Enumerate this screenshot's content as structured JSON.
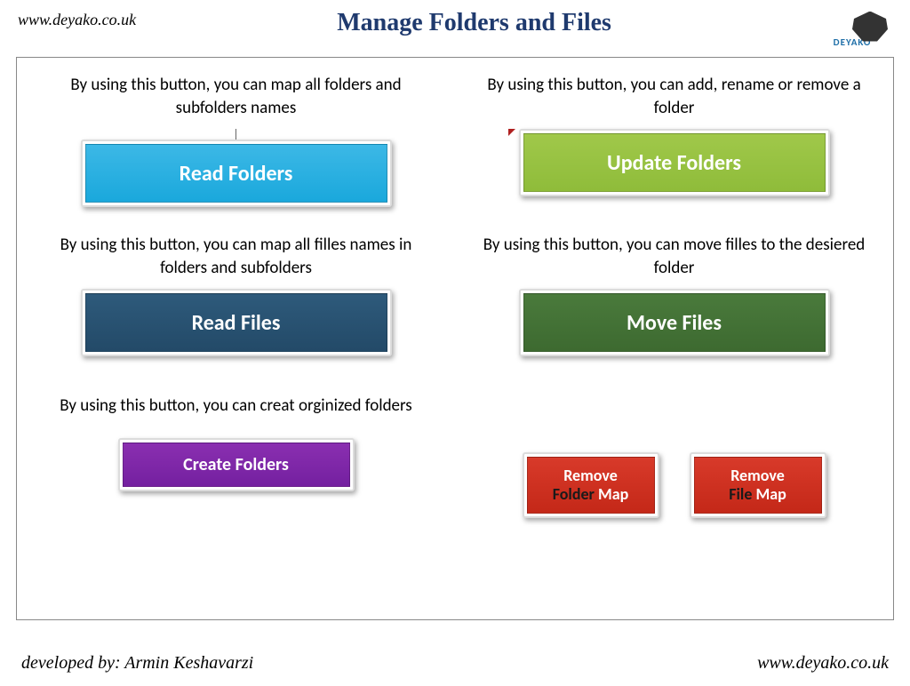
{
  "header": {
    "url_top": "www.deyako.co.uk",
    "title": "Manage Folders and Files",
    "logo_text": "DEYAKO"
  },
  "cells": {
    "read_folders": {
      "desc": "By using this button, you can map all folders and subfolders names",
      "label": "Read Folders"
    },
    "update_folders": {
      "desc": "By using this button, you can add, rename or remove a folder",
      "label": "Update Folders"
    },
    "read_files": {
      "desc": "By using this button, you can map all filles names in folders and subfolders",
      "label": "Read Files"
    },
    "move_files": {
      "desc": "By using this button, you can move filles to the desiered folder",
      "label": "Move Files"
    },
    "create_folders": {
      "desc": "By using this button, you can creat orginized folders",
      "label": "Create Folders"
    },
    "remove_folder_map": {
      "word1": "Remove",
      "word2": "Folder",
      "word3": "Map"
    },
    "remove_file_map": {
      "word1": "Remove",
      "word2": "File",
      "word3": "Map"
    }
  },
  "footer": {
    "developer": "developed by: Armin Keshavarzi",
    "url_bottom": "www.deyako.co.uk"
  }
}
